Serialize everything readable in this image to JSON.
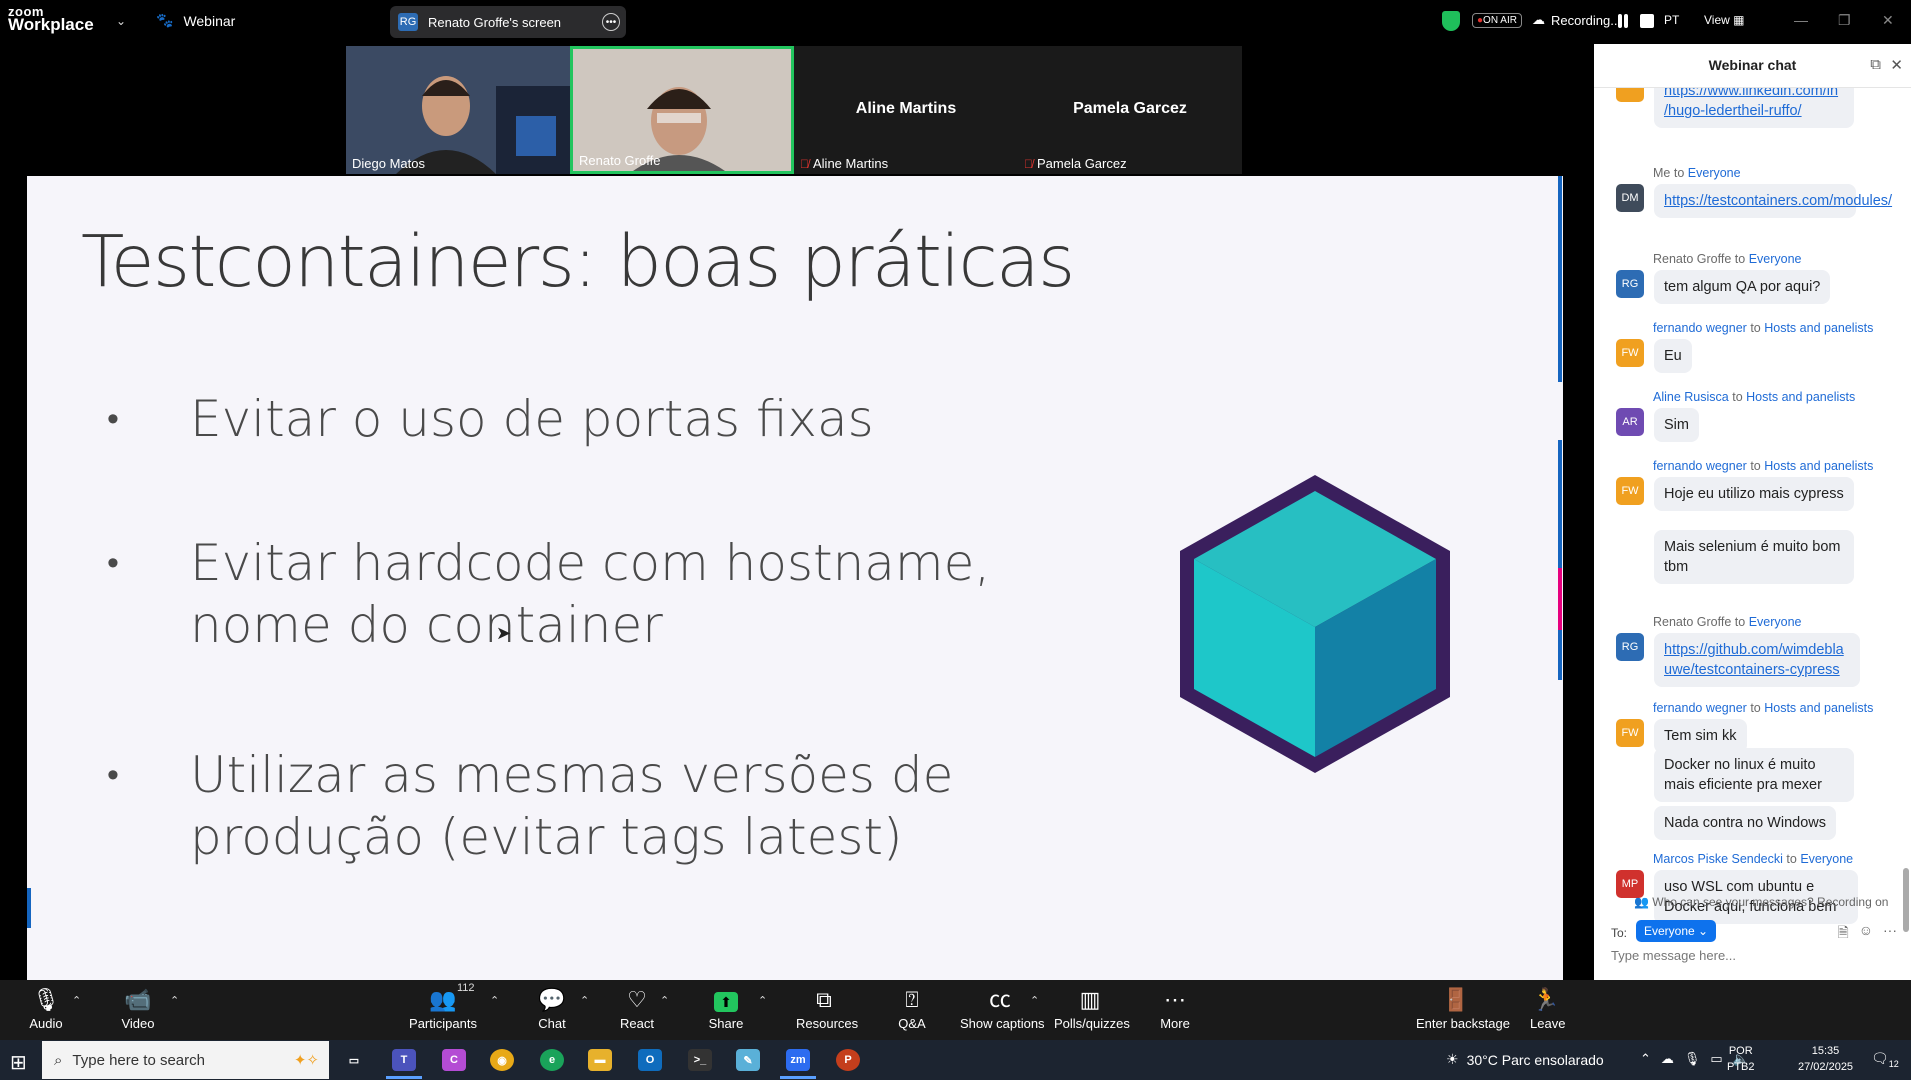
{
  "topbar": {
    "logo_line1": "zoom",
    "logo_line2": "Workplace",
    "webinar_label": "Webinar",
    "screen_share_initials": "RG",
    "screen_share_label": "Renato Groffe's screen",
    "on_air": "ON AIR",
    "recording": "Recording...",
    "lang": "PT",
    "view": "View"
  },
  "participants": [
    {
      "name": "Diego Matos",
      "video": true,
      "muted": false
    },
    {
      "name": "Renato Groffe",
      "video": true,
      "muted": false,
      "active": true
    },
    {
      "name": "Aline Martins",
      "video": false,
      "muted": true
    },
    {
      "name": "Pamela Garcez",
      "video": false,
      "muted": true
    }
  ],
  "slide": {
    "title": "Testcontainers: boas práticas",
    "bullets": [
      "Evitar o uso de portas fixas",
      "Evitar hardcode com hostname, nome do container",
      "Utilizar as mesmas versões de produção (evitar tags latest)"
    ],
    "cube_colors": {
      "outline": "#3a1f5d",
      "top": "#27bfc2",
      "left": "#1ec7c9",
      "right": "#1381a6"
    }
  },
  "chat": {
    "title": "Webinar chat",
    "messages": [
      {
        "sender": "",
        "recipient": "",
        "initials": "",
        "text": "/hugo-ledertheil-ruffo/",
        "link_top": "https://www.linkedin.com/in",
        "is_link": true
      },
      {
        "sender": "Me",
        "recipient": "Everyone",
        "initials": "DM",
        "avatar_color": "#3f4b5b",
        "text": "https://testcontainers.com/modules/",
        "is_link": true
      },
      {
        "sender": "Renato Groffe",
        "recipient": "Everyone",
        "initials": "RG",
        "avatar_color": "#2d6cb4",
        "text": "tem algum QA por aqui?"
      },
      {
        "sender": "fernando wegner",
        "recipient": "Hosts and panelists",
        "initials": "FW",
        "avatar_color": "#f0a020",
        "text": "Eu"
      },
      {
        "sender": "Aline Rusisca",
        "recipient": "Hosts and panelists",
        "initials": "AR",
        "avatar_color": "#6f4bb2",
        "text": "Sim"
      },
      {
        "sender": "fernando wegner",
        "recipient": "Hosts and panelists",
        "initials": "FW",
        "avatar_color": "#f0a020",
        "text": "Hoje eu utilizo mais cypress"
      },
      {
        "sender": "",
        "recipient": "",
        "initials": "",
        "text": "Mais selenium é muito bom tbm"
      },
      {
        "sender": "Renato Groffe",
        "recipient": "Everyone",
        "initials": "RG",
        "avatar_color": "#2d6cb4",
        "text": "https://github.com/wimdeblauwe/testcontainers-cypress",
        "is_link": true
      },
      {
        "sender": "fernando wegner",
        "recipient": "Hosts and panelists",
        "initials": "FW",
        "avatar_color": "#f0a020",
        "text": "Tem sim kk"
      },
      {
        "sender": "",
        "recipient": "",
        "initials": "",
        "text": "Docker no linux é muito mais eficiente pra mexer"
      },
      {
        "sender": "",
        "recipient": "",
        "initials": "",
        "text": "Nada contra no Windows"
      },
      {
        "sender": "Marcos Piske Sendecki",
        "recipient": "Everyone",
        "initials": "MP",
        "avatar_color": "#d0312d",
        "text": "uso WSL com ubuntu e Docker aqui, funciona bem"
      }
    ],
    "to_word": "to",
    "who_can_see": "Who can see your messages? Recording on",
    "to_label": "To:",
    "to_value": "Everyone",
    "input_placeholder": "Type message here..."
  },
  "toolbar": {
    "audio": "Audio",
    "video": "Video",
    "participants": "Participants",
    "participants_count": "112",
    "chat": "Chat",
    "react": "React",
    "share": "Share",
    "resources": "Resources",
    "qa": "Q&A",
    "captions": "Show captions",
    "polls": "Polls/quizzes",
    "more": "More",
    "backstage": "Enter backstage",
    "leave": "Leave"
  },
  "taskbar": {
    "search_placeholder": "Type here to search",
    "weather": "30°C  Parc ensolarado",
    "lang_line1": "POR",
    "lang_line2": "PTB2",
    "time": "15:35",
    "date": "27/02/2025",
    "notif_count": "12"
  }
}
